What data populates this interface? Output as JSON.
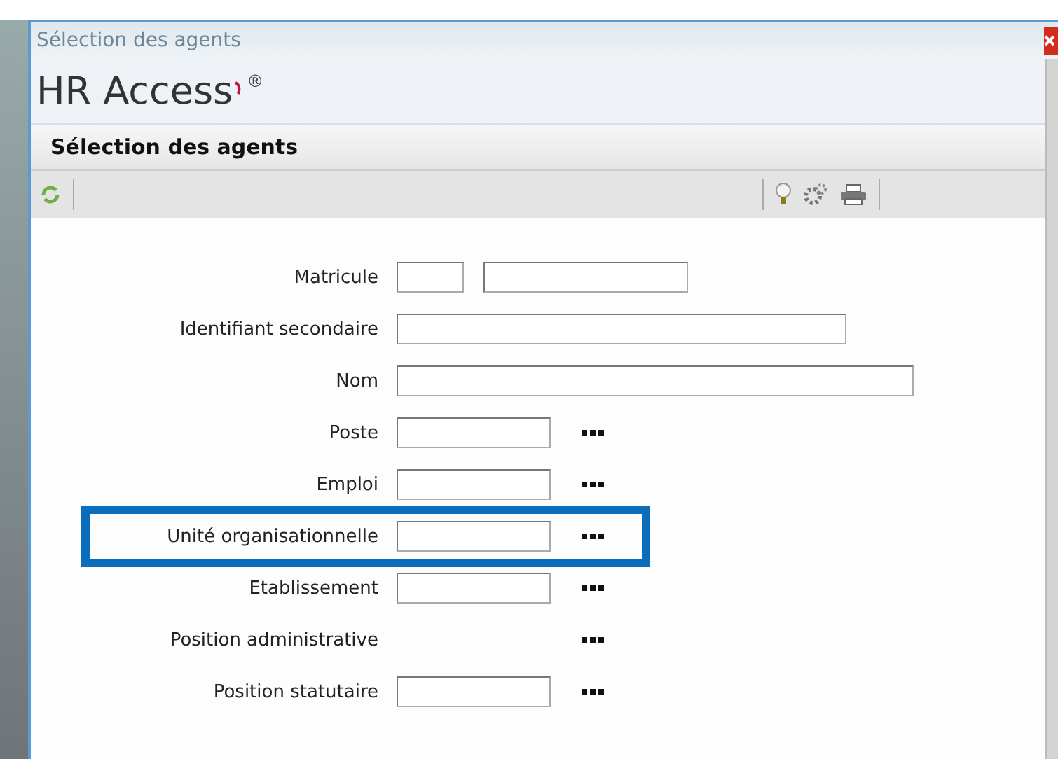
{
  "window": {
    "title": "Sélection des agents"
  },
  "brand": {
    "name": "HR Access",
    "mark": "®"
  },
  "header": {
    "title": "Sélection des agents"
  },
  "toolbar": {
    "left": [
      {
        "kind": "refresh"
      }
    ],
    "right": [
      {
        "kind": "bulb"
      },
      {
        "kind": "gears"
      },
      {
        "kind": "print"
      }
    ]
  },
  "form": {
    "rows": [
      {
        "label": "Matricule",
        "fields": [
          {
            "kind": "code"
          },
          {
            "kind": "normal"
          }
        ],
        "lookup": false,
        "highlighted": false
      },
      {
        "label": "Identifiant secondaire",
        "fields": [
          {
            "kind": "wide"
          }
        ],
        "lookup": false,
        "highlighted": false
      },
      {
        "label": "Nom",
        "fields": [
          {
            "kind": "full"
          }
        ],
        "lookup": false,
        "highlighted": false
      },
      {
        "label": "Poste",
        "fields": [
          {
            "kind": "short"
          }
        ],
        "lookup": true,
        "highlighted": false
      },
      {
        "label": "Emploi",
        "fields": [
          {
            "kind": "short"
          }
        ],
        "lookup": true,
        "highlighted": false
      },
      {
        "label": "Unité organisationnelle",
        "fields": [
          {
            "kind": "short"
          }
        ],
        "lookup": true,
        "highlighted": true
      },
      {
        "label": "Etablissement",
        "fields": [
          {
            "kind": "short"
          }
        ],
        "lookup": true,
        "highlighted": false
      },
      {
        "label": "Position administrative",
        "fields": [],
        "lookup": true,
        "highlighted": false
      },
      {
        "label": "Position statutaire",
        "fields": [
          {
            "kind": "short"
          }
        ],
        "lookup": true,
        "highlighted": false
      }
    ]
  }
}
